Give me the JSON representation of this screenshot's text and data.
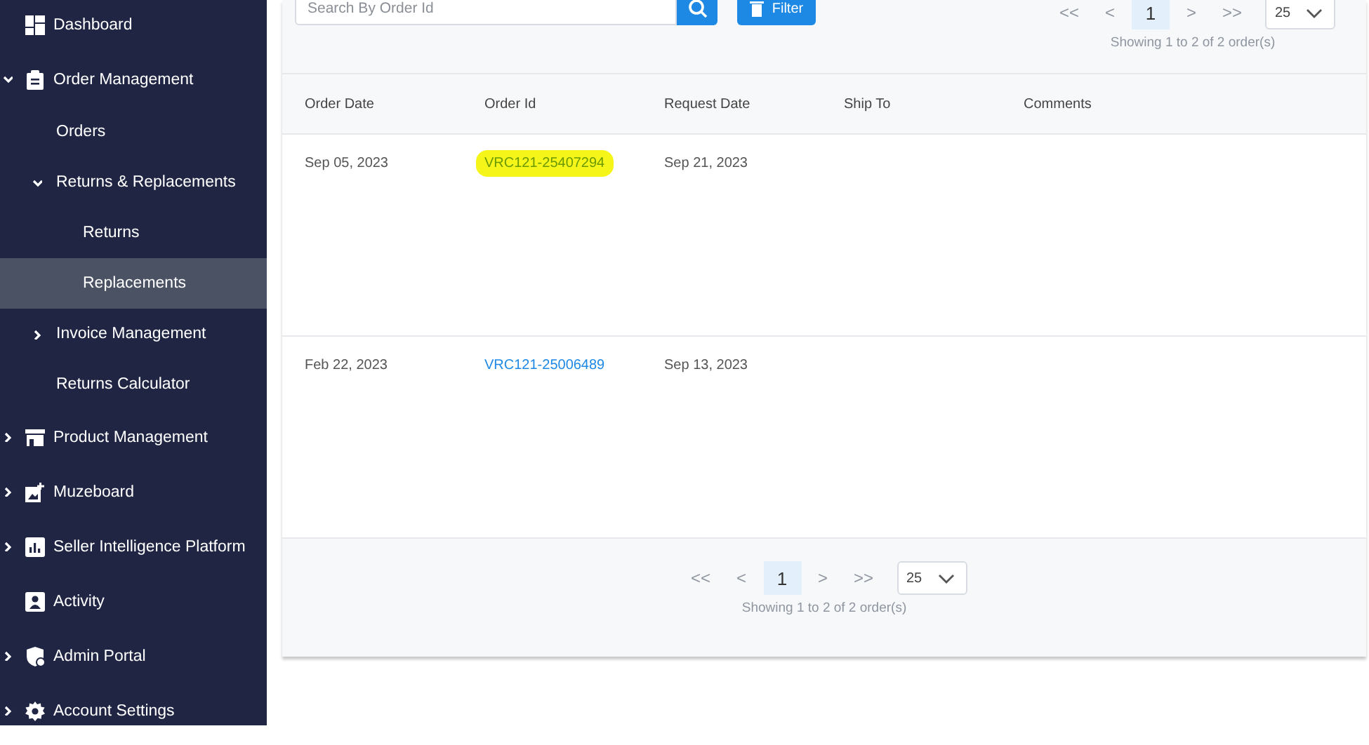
{
  "sidebar": {
    "items": [
      {
        "label": "Dashboard",
        "selected": false
      },
      {
        "label": "Order Management",
        "selected": false,
        "expanded": true,
        "children": [
          {
            "label": "Orders",
            "selected": false
          },
          {
            "label": "Returns & Replacements",
            "selected": false,
            "expanded": true,
            "children": [
              {
                "label": "Returns",
                "selected": false
              },
              {
                "label": "Replacements",
                "selected": true
              }
            ]
          },
          {
            "label": "Invoice Management",
            "selected": false,
            "expanded": false
          },
          {
            "label": "Returns Calculator",
            "selected": false
          }
        ]
      },
      {
        "label": "Product Management",
        "selected": false,
        "expanded": false
      },
      {
        "label": "Muzeboard",
        "selected": false,
        "expanded": false
      },
      {
        "label": "Seller Intelligence Platform",
        "selected": false,
        "expanded": false
      },
      {
        "label": "Activity",
        "selected": false
      },
      {
        "label": "Admin Portal",
        "selected": false,
        "expanded": false
      },
      {
        "label": "Account Settings",
        "selected": false,
        "expanded": false
      }
    ]
  },
  "toolbar": {
    "search": {
      "placeholder": "Search By Order Id"
    },
    "filter_button": "Filter"
  },
  "top_pagination": {
    "first": "<<",
    "prev": "<",
    "pages": [
      {
        "label": "1",
        "selected": true
      }
    ],
    "next": ">",
    "last": ">>",
    "page_size": "25",
    "summary": "Showing 1 to 2 of 2 order(s)"
  },
  "table": {
    "columns": [
      "Order Date",
      "Order Id",
      "Request Date",
      "Ship To",
      "Comments"
    ],
    "rows": [
      {
        "order_date": "Sep 05, 2023",
        "order_id": "VRC121-25407294",
        "request_date": "Sep 21, 2023",
        "highlighted": true
      },
      {
        "order_date": "Feb 22, 2023",
        "order_id": "VRC121-25006489",
        "request_date": "Sep 13, 2023",
        "highlighted": false
      }
    ]
  },
  "bottom_pagination": {
    "first": "<<",
    "prev": "<",
    "pages": [
      {
        "label": "1",
        "selected": true
      }
    ],
    "next": ">",
    "last": ">>",
    "page_size": "25",
    "summary": "Showing 1 to 2 of 2 order(s)"
  }
}
